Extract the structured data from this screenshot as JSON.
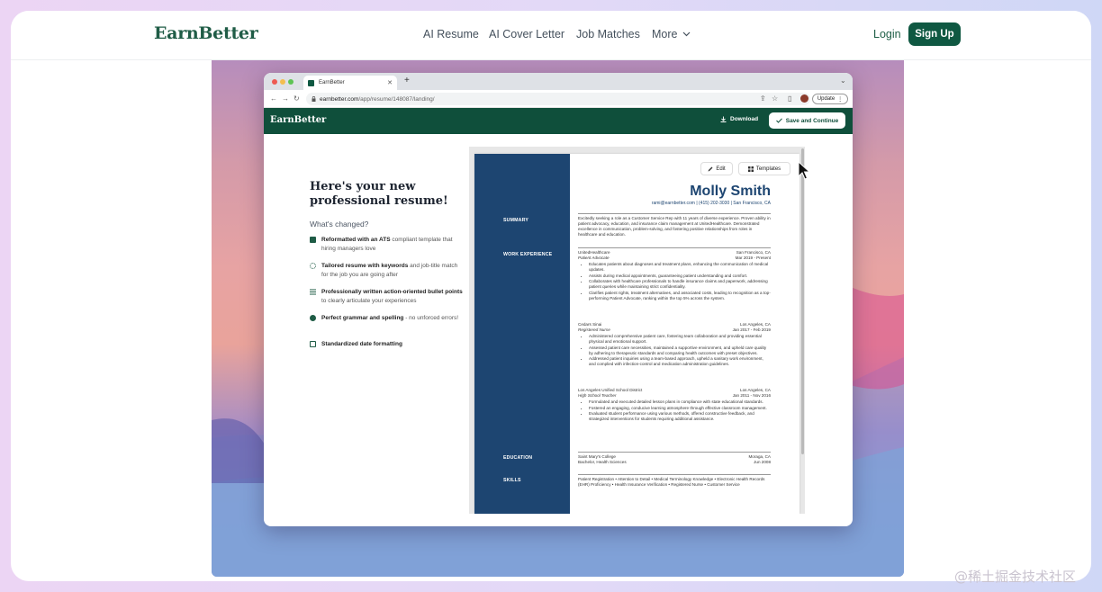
{
  "site": {
    "logo": "EarnBetter",
    "nav": [
      "AI Resume",
      "AI Cover Letter",
      "Job Matches",
      "More"
    ],
    "login": "Login",
    "signup": "Sign Up"
  },
  "browser": {
    "tab_title": "EarnBetter",
    "url_host": "earnbetter.com",
    "url_path": "/app/resume/148087/landing/",
    "update_label": "Update",
    "profile_initial": "B"
  },
  "app": {
    "logo": "EarnBetter",
    "download_label": "Download",
    "save_label": "Save and Continue"
  },
  "landing": {
    "headline": "Here's your new professional resume!",
    "changed_label": "What's changed?",
    "features": [
      {
        "bold": "Reformatted with an ATS",
        "text": " compliant template that hiring managers love",
        "icon": "layers-icon",
        "color": "#1f5c46"
      },
      {
        "bold": "Tailored resume with keywords",
        "text": " and job-title match for the job you are going after",
        "icon": "target-icon",
        "color": "#1f5c46"
      },
      {
        "bold": "Professionally written action-oriented bullet points",
        "text": " to clearly articulate your experiences",
        "icon": "list-icon",
        "color": "#1f5c46"
      },
      {
        "bold": "Perfect grammar and spelling",
        "text": " - no unforced errors!",
        "icon": "check-circle-icon",
        "color": "#1f5c46"
      },
      {
        "bold": "Standardized date formatting",
        "text": "",
        "icon": "calendar-icon",
        "color": "#1f5c46"
      }
    ]
  },
  "resume": {
    "edit_label": "Edit",
    "templates_label": "Templates",
    "name": "Molly Smith",
    "contact": "rami@earnbetter.com | (415) 202-3030 | San Francisco, CA",
    "sections": {
      "summary": "SUMMARY",
      "work": "WORK EXPERIENCE",
      "education": "EDUCATION",
      "skills": "SKILLS"
    },
    "summary": "Excitedly seeking a role as a Customer Service Rep with 11 years of diverse experience. Proven ability in patient advocacy, education, and insurance claim management at UnitedHealthcare. Demonstrated excellence in communication, problem-solving, and fostering positive relationships from roles in healthcare and education.",
    "jobs": [
      {
        "company": "UnitedHealthcare",
        "location": "San Francisco, CA",
        "title": "Patient Advocate",
        "dates": "Mar 2019 - Present",
        "bullets": [
          "Educates patients about diagnoses and treatment plans, enhancing the communication of medical updates.",
          "Assists during medical appointments, guaranteeing patient understanding and comfort.",
          "Collaborates with healthcare professionals to handle insurance claims and paperwork, addressing patient queries while maintaining strict confidentiality.",
          "Clarifies patient rights, treatment alternatives, and associated costs, leading to recognition as a top-performing Patient Advocate, ranking within the top 5% across the system."
        ]
      },
      {
        "company": "Cedars Sinai",
        "location": "Los Angeles, CA",
        "title": "Registered Nurse",
        "dates": "Jan 2017 - Feb 2019",
        "bullets": [
          "Administered comprehensive patient care, fostering team collaboration and providing essential physical and emotional support.",
          "Assessed patient care necessities, maintained a supportive environment, and upheld care quality by adhering to therapeutic standards and comparing health outcomes with preset objectives.",
          "Addressed patient inquiries using a team-based approach, upheld a sanitary work environment, and complied with infection-control and medication administration guidelines."
        ]
      },
      {
        "company": "Los Angeles Unified School District",
        "location": "Los Angeles, CA",
        "title": "High School Teacher",
        "dates": "Jan 2011 - Nov 2016",
        "bullets": [
          "Formulated and executed detailed lesson plans in compliance with state educational standards.",
          "Fostered an engaging, conducive learning atmosphere through effective classroom management.",
          "Evaluated student performance using various methods, offered constructive feedback, and strategized interventions for students requiring additional assistance."
        ]
      }
    ],
    "education": {
      "school": "Saint Mary's College",
      "location": "Moraga, CA",
      "degree": "Bachelor, Health Sciences",
      "date": "Jun 2008"
    },
    "skills": "Patient Registration • Attention to Detail • Medical Terminology Knowledge • Electronic Health Records (EHR) Proficiency • Health Insurance Verification • Registered Nurse • Customer Service"
  },
  "colors": {
    "brand_green": "#0f5842",
    "resume_navy": "#1d4571"
  },
  "watermark": "@稀土掘金技术社区"
}
